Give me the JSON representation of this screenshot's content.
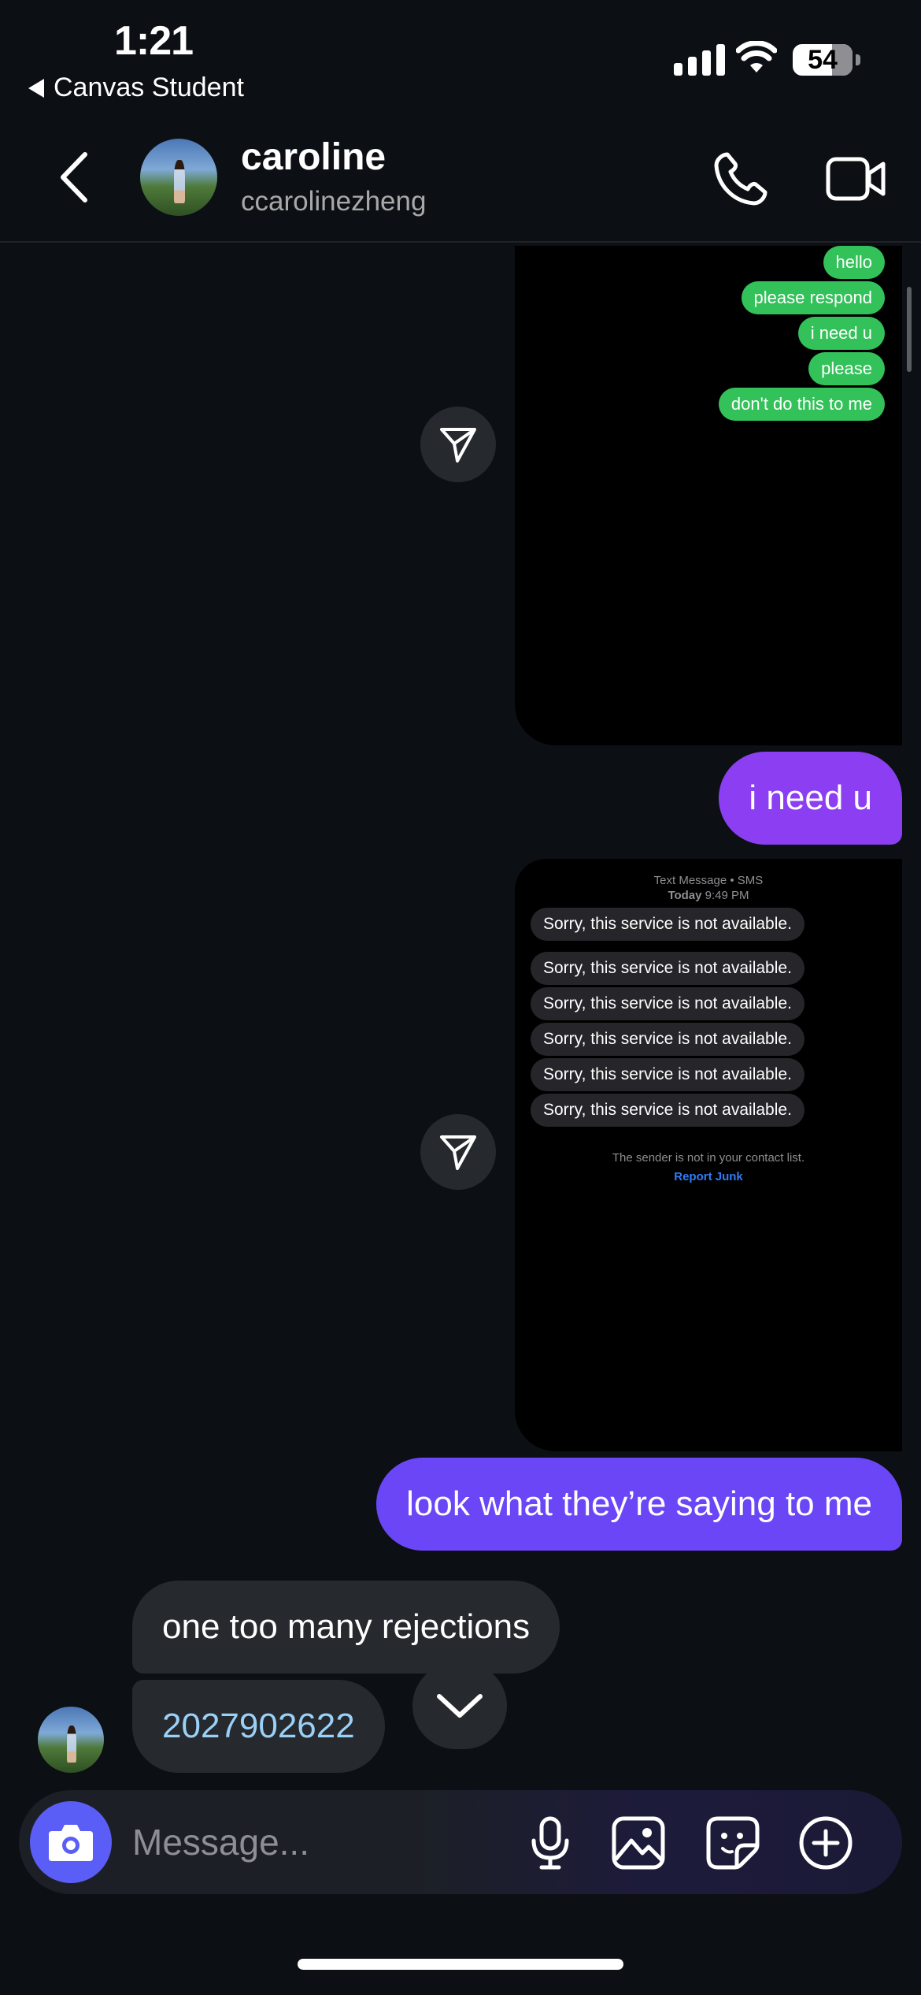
{
  "status_bar": {
    "time": "1:21",
    "back_app": "Canvas Student",
    "battery": "54"
  },
  "header": {
    "name": "caroline",
    "username": "ccarolinezheng"
  },
  "shared_image_1": {
    "bubbles": [
      "hello",
      "please respond",
      "i need u",
      "please",
      "don't do this to me"
    ],
    "bubble_color": "#33c15a"
  },
  "outgoing": [
    {
      "text": "i need u",
      "color": "#8c3ff2"
    },
    {
      "text": "look what they’re saying to me",
      "color": "#6a46f6"
    }
  ],
  "shared_image_2": {
    "header_line1": "Text Message • SMS",
    "header_line2_bold": "Today",
    "header_line2_time": "9:49 PM",
    "bubbles": [
      "Sorry, this service is not available.",
      "Sorry, this service is not available.",
      "Sorry, this service is not available.",
      "Sorry, this service is not available.",
      "Sorry, this service is not available.",
      "Sorry, this service is not available."
    ],
    "footer": "The sender is not in your contact list.",
    "report_link": "Report Junk"
  },
  "incoming": [
    {
      "text": "one too many rejections"
    },
    {
      "text": "2027902622"
    }
  ],
  "composer": {
    "placeholder": "Message...",
    "accent": "#5b5ef6"
  },
  "icons": [
    "back-chevron-icon",
    "phone-icon",
    "video-camera-icon",
    "send-icon",
    "chevron-down-icon",
    "camera-icon",
    "microphone-icon",
    "gallery-icon",
    "sticker-icon",
    "plus-circle-icon"
  ]
}
